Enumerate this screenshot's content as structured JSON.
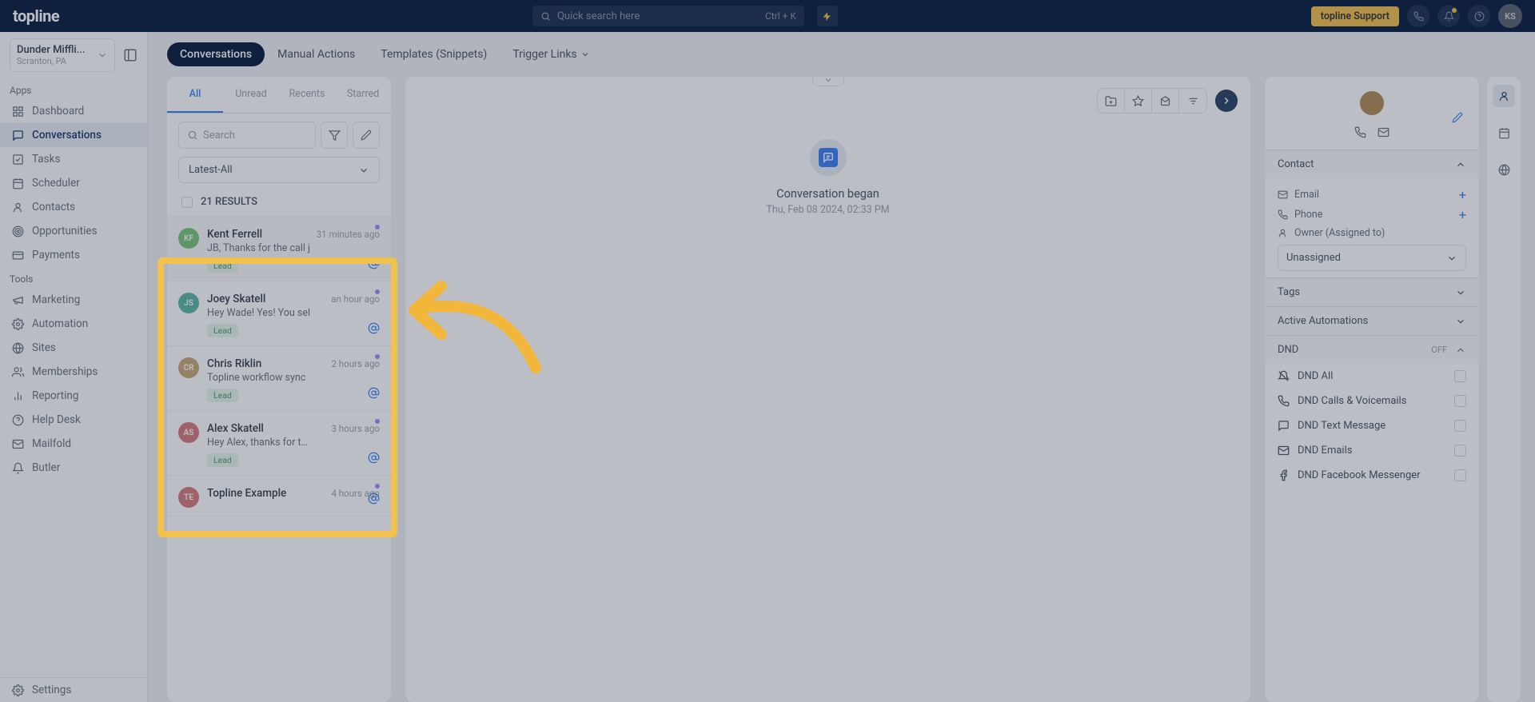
{
  "brand": "topline",
  "search": {
    "placeholder": "Quick search here",
    "kbd": "Ctrl + K"
  },
  "support_label": "topline Support",
  "avatar_initials": "KS",
  "org": {
    "name": "Dunder Miffli...",
    "sub": "Scranton, PA"
  },
  "sidebar": {
    "section_apps": "Apps",
    "section_tools": "Tools",
    "apps": [
      {
        "label": "Dashboard",
        "icon": "grid"
      },
      {
        "label": "Conversations",
        "icon": "chat",
        "active": true
      },
      {
        "label": "Tasks",
        "icon": "check"
      },
      {
        "label": "Scheduler",
        "icon": "calendar"
      },
      {
        "label": "Contacts",
        "icon": "person"
      },
      {
        "label": "Opportunities",
        "icon": "target"
      },
      {
        "label": "Payments",
        "icon": "card"
      }
    ],
    "tools": [
      {
        "label": "Marketing",
        "icon": "megaphone"
      },
      {
        "label": "Automation",
        "icon": "gear"
      },
      {
        "label": "Sites",
        "icon": "globe"
      },
      {
        "label": "Memberships",
        "icon": "people"
      },
      {
        "label": "Reporting",
        "icon": "chart"
      },
      {
        "label": "Help Desk",
        "icon": "help"
      },
      {
        "label": "Mailfold",
        "icon": "mail"
      },
      {
        "label": "Butler",
        "icon": "bell"
      }
    ],
    "settings_label": "Settings"
  },
  "tabs": [
    {
      "label": "Conversations",
      "active": true
    },
    {
      "label": "Manual Actions"
    },
    {
      "label": "Templates (Snippets)"
    },
    {
      "label": "Trigger Links",
      "dropdown": true
    }
  ],
  "list_tabs": [
    "All",
    "Unread",
    "Recents",
    "Starred"
  ],
  "search_placeholder": "Search",
  "sort_label": "Latest-All",
  "results_label": "21 RESULTS",
  "conversations": [
    {
      "initials": "KF",
      "color": "#7bc67b",
      "name": "Kent Ferrell",
      "time": "31 minutes ago",
      "preview": "JB, Thanks for the call j",
      "tag": "Lead",
      "selected": true
    },
    {
      "initials": "JS",
      "color": "#5bb8a5",
      "name": "Joey Skatell",
      "time": "an hour ago",
      "preview": "Hey Wade! Yes! You sel",
      "tag": "Lead"
    },
    {
      "initials": "CR",
      "color": "#c9a876",
      "name": "Chris Riklin",
      "time": "2 hours ago",
      "preview": "Topline workflow sync",
      "tag": "Lead"
    },
    {
      "initials": "AS",
      "color": "#d67b7b",
      "name": "Alex Skatell",
      "time": "3 hours ago",
      "preview": "Hey Alex, thanks for the",
      "tag": "Lead"
    },
    {
      "initials": "TE",
      "color": "#d67b7b",
      "name": "Topline Example",
      "time": "4 hours ago",
      "preview": "",
      "tag": ""
    }
  ],
  "center": {
    "began": "Conversation began",
    "date": "Thu, Feb 08 2024, 02:33 PM"
  },
  "contact": {
    "section_label": "Contact",
    "email_label": "Email",
    "phone_label": "Phone",
    "owner_label": "Owner (Assigned to)",
    "owner_value": "Unassigned",
    "tags_label": "Tags",
    "automations_label": "Active Automations",
    "dnd_label": "DND",
    "dnd_status": "OFF",
    "dnd_items": [
      {
        "label": "DND All",
        "icon": "bell-off"
      },
      {
        "label": "DND Calls & Voicemails",
        "icon": "phone"
      },
      {
        "label": "DND Text Message",
        "icon": "msg"
      },
      {
        "label": "DND Emails",
        "icon": "mail"
      },
      {
        "label": "DND Facebook Messenger",
        "icon": "fb"
      }
    ]
  }
}
